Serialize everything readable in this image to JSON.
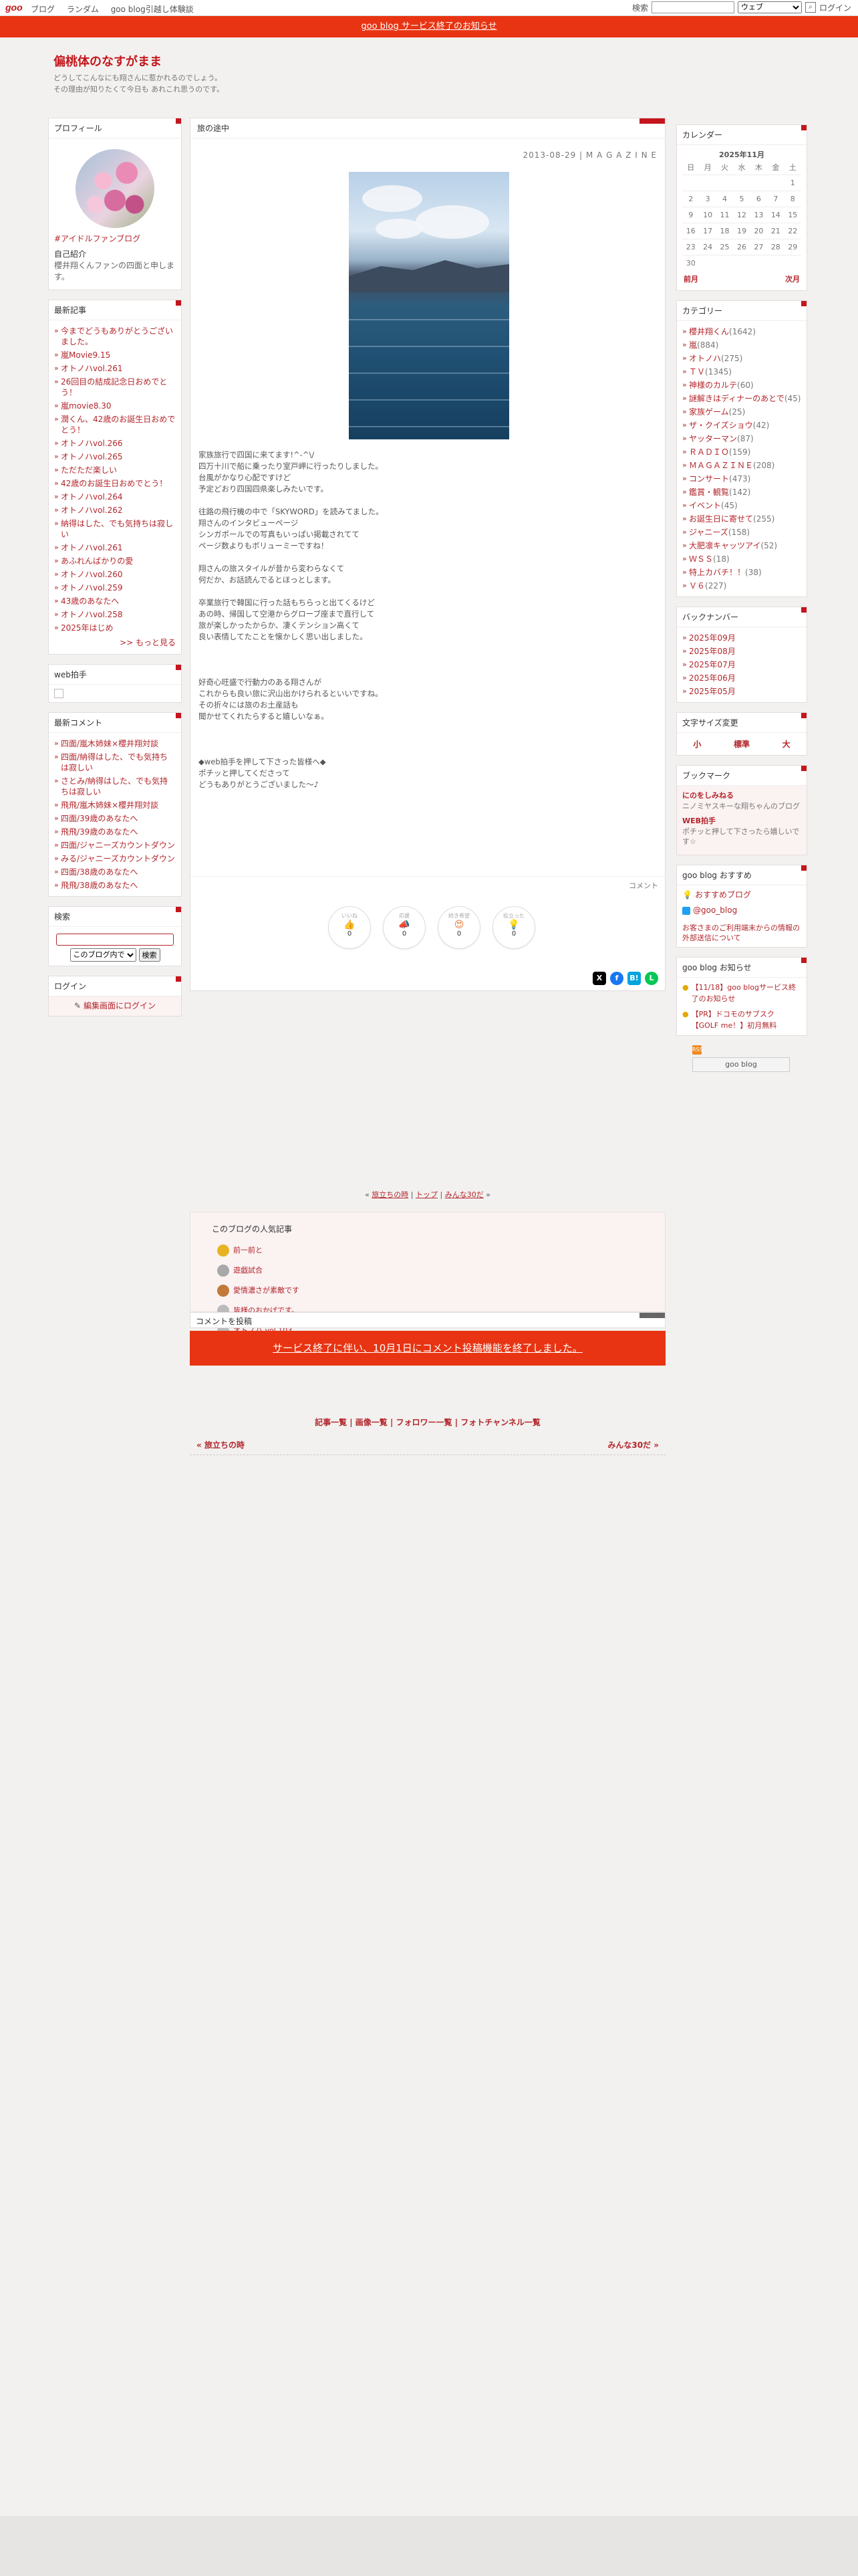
{
  "topbar": {
    "logo": "goo",
    "nav": [
      "ブログ",
      "ランダム",
      "goo blog引越し体験談"
    ],
    "search_label": "検索",
    "search_select": "ウェブ",
    "login": "ログイン"
  },
  "banner": "goo blog サービス終了のお知らせ",
  "blog": {
    "title": "偏桃体のなすがまま",
    "desc1": "どうしてこんなにも翔さんに惹かれるのでしょう。",
    "desc2": "その理由が知りたくて今日も あれこれ思うのです。"
  },
  "profile": {
    "title": "プロフィール",
    "link": "#アイドルファンブログ",
    "intro_label": "自己紹介",
    "intro": "櫻井翔くんファンの四面と申します。"
  },
  "recent": {
    "title": "最新記事",
    "items": [
      "今までどうもありがとうございました。",
      "嵐Movie9.15",
      "オトノハvol.261",
      "26回目の結成記念日おめでとう！",
      "嵐movie8.30",
      "潤くん、42歳のお誕生日おめでとう！",
      "オトノハvol.266",
      "オトノハvol.265",
      "ただただ楽しい",
      "42歳のお誕生日おめでとう！",
      "オトノハvol.264",
      "オトノハvol.262",
      "納得はした、でも気持ちは寂しい",
      "オトノハvol.261",
      "あふれんばかりの愛",
      "オトノハvol.260",
      "オトノハvol.259",
      "43歳のあなたへ",
      "オトノハvol.258",
      "2025年はじめ"
    ],
    "more": ">> もっと見る"
  },
  "clap": {
    "title": "web拍手"
  },
  "comments": {
    "title": "最新コメント",
    "items": [
      "四面/嵐木姉妹×櫻井翔対談",
      "四面/納得はした、でも気持ちは寂しい",
      "さとみ/納得はした、でも気持ちは寂しい",
      "飛飛/嵐木姉妹×櫻井翔対談",
      "四面/39歳のあなたへ",
      "飛飛/39歳のあなたへ",
      "四面/ジャニーズカウントダウン",
      "みる/ジャニーズカウントダウン",
      "四面/38歳のあなたへ",
      "飛飛/38歳のあなたへ"
    ]
  },
  "search": {
    "title": "検索",
    "select": "このブログ内で",
    "button": "検索"
  },
  "login": {
    "title": "ログイン",
    "link": "編集画面にログイン"
  },
  "article": {
    "title": "旅の途中",
    "date": "2013-08-29 | M A G A Z I N E",
    "paragraphs": [
      [
        "家族旅行で四国に来てます!^-^\\/",
        "四万十川で船に乗ったり室戸岬に行ったりしました。",
        "台風がかなり心配ですけど",
        "予定どおり四国四県楽しみたいです。"
      ],
      [
        "往路の飛行機の中で「SKYWORD」を読みてました。",
        "翔さんのインタビューページ",
        "シンガポールでの写真もいっぱい掲載されてて",
        "ページ数よりもボリューミーですね！"
      ],
      [
        "翔さんの旅スタイルが昔から変わらなくて",
        "何だか、お話読んでるとほっとします。"
      ],
      [
        "卒業旅行で韓国に行った話もちらっと出てくるけど",
        "あの時、帰国して空港からグローブ座まで直行して",
        "旅が楽しかったからか、凄くテンション高くて",
        "良い表情してたことを懐かしく思い出しました。"
      ],
      [
        ""
      ],
      [
        "好奇心旺盛で行動力のある翔さんが",
        "これからも良い旅に沢山出かけられるといいですね。",
        "その折々には旅のお土産話も",
        "聞かせてくれたらすると嬉しいなぁ。"
      ],
      [
        ""
      ],
      [
        "◆web拍手を押して下さった皆様へ◆",
        "ポチッと押してくださって",
        "どうもありがとうございました〜♪"
      ]
    ],
    "comment_link": "コメント",
    "reactions": [
      {
        "label": "いいね",
        "icon": "👍",
        "count": "0"
      },
      {
        "label": "応援",
        "icon": "📣",
        "count": "0"
      },
      {
        "label": "続き希望",
        "icon": "😍",
        "count": "0"
      },
      {
        "label": "役立った",
        "icon": "💡",
        "count": "0"
      }
    ]
  },
  "calendar": {
    "title": "カレンダー",
    "month": "2025年11月",
    "days": [
      "日",
      "月",
      "火",
      "水",
      "木",
      "金",
      "土"
    ],
    "weeks": [
      [
        "",
        "",
        "",
        "",
        "",
        "",
        "1"
      ],
      [
        "2",
        "3",
        "4",
        "5",
        "6",
        "7",
        "8"
      ],
      [
        "9",
        "10",
        "11",
        "12",
        "13",
        "14",
        "15"
      ],
      [
        "16",
        "17",
        "18",
        "19",
        "20",
        "21",
        "22"
      ],
      [
        "23",
        "24",
        "25",
        "26",
        "27",
        "28",
        "29"
      ],
      [
        "30",
        "",
        "",
        "",
        "",
        "",
        ""
      ]
    ],
    "prev": "前月",
    "next": "次月"
  },
  "categories": {
    "title": "カテゴリー",
    "items": [
      [
        "櫻井翔くん",
        "(1642)"
      ],
      [
        "嵐",
        "(884)"
      ],
      [
        "オトノハ",
        "(275)"
      ],
      [
        "ＴＶ",
        "(1345)"
      ],
      [
        "神様のカルテ",
        "(60)"
      ],
      [
        "謎解きはディナーのあとで",
        "(45)"
      ],
      [
        "家族ゲーム",
        "(25)"
      ],
      [
        "ザ・クイズショウ",
        "(42)"
      ],
      [
        "ヤッターマン",
        "(87)"
      ],
      [
        "ＲＡＤＩＯ",
        "(159)"
      ],
      [
        "ＭＡＧＡＺＩＮＥ",
        "(208)"
      ],
      [
        "コンサート",
        "(473)"
      ],
      [
        "鑑賞・観覧",
        "(142)"
      ],
      [
        "イベント",
        "(45)"
      ],
      [
        "お誕生日に寄せて",
        "(255)"
      ],
      [
        "ジャニーズ",
        "(158)"
      ],
      [
        "大肥凛キャッツアイ",
        "(52)"
      ],
      [
        "ＷＳＳ",
        "(18)"
      ],
      [
        "特上カバチ！！",
        "(38)"
      ],
      [
        "Ｖ６",
        "(227)"
      ]
    ]
  },
  "backnumber": {
    "title": "バックナンバー",
    "items": [
      "2025年09月",
      "2025年08月",
      "2025年07月",
      "2025年06月",
      "2025年05月"
    ]
  },
  "fontsize": {
    "title": "文字サイズ変更",
    "small": "小",
    "medium": "標準",
    "large": "大"
  },
  "bookmarks": {
    "title": "ブックマーク",
    "items": [
      {
        "name": "にのをしみねる",
        "desc": "ニノミヤスキーな翔ちゃんのブログ"
      },
      {
        "name": "WEB拍手",
        "desc": "ポチッと押して下さったら嬉しいです☆"
      }
    ]
  },
  "goo_recommend": {
    "title": "goo blog おすすめ",
    "item1": "おすすめブログ",
    "item2": "@goo_blog",
    "notice": "お客さまのご利用端末からの情報の外部送信について"
  },
  "goo_news": {
    "title": "goo blog お知らせ",
    "items": [
      "【11/18】goo blogサービス終了のお知らせ",
      "【PR】ドコモのサブスク【GOLF me！】初月無料"
    ]
  },
  "goo_badge": "goo blog",
  "crumbs": {
    "left": "旅立ちの時",
    "mid": "トップ",
    "right": "みんな30だ"
  },
  "popular": {
    "title": "このブログの人気記事",
    "items": [
      "前一前と",
      "遊戯試合",
      "愛情濃さが素敵です",
      "皆様のおかげです。",
      "オトノハ vol.103"
    ]
  },
  "comment_post": {
    "title": "コメントを投稿",
    "closed": "サービス終了に伴い、10月1日にコメント投稿機能を終了しました。"
  },
  "bottom_links": "記事一覧 | 画像一覧 | フォロワー一覧 | フォトチャンネル一覧",
  "prevnext": {
    "prev": "« 旅立ちの時",
    "next": "みんな30だ »"
  }
}
